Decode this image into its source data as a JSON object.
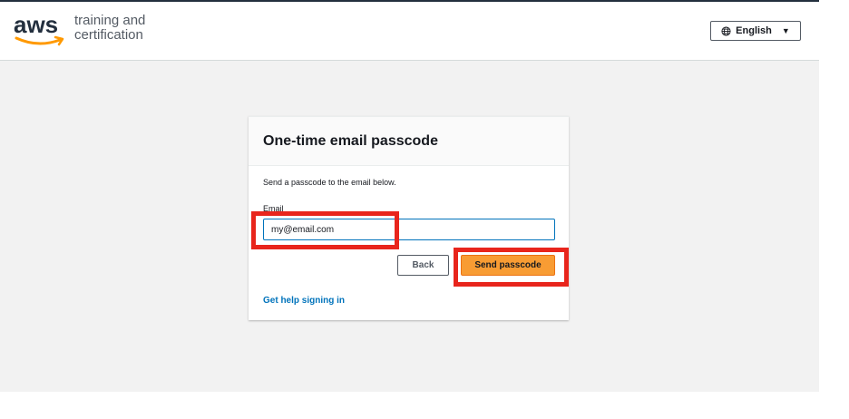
{
  "header": {
    "logo": {
      "wordmark": "aws",
      "tagline_line1": "training and",
      "tagline_line2": "certification"
    },
    "language_selector": {
      "icon": "globe-icon",
      "label": "English",
      "caret": "▼"
    }
  },
  "card": {
    "title": "One-time email passcode",
    "description": "Send a passcode to the email below.",
    "email_label": "Email",
    "email_value": "my@email.com",
    "back_label": "Back",
    "send_label": "Send passcode",
    "help_link": "Get help signing in"
  },
  "colors": {
    "brand_dark": "#232f3e",
    "smile_orange": "#ff9900",
    "primary_button": "#f89c33",
    "link_blue": "#0073bb",
    "annotation_red": "#e8251c",
    "page_background": "#f2f2f2"
  }
}
